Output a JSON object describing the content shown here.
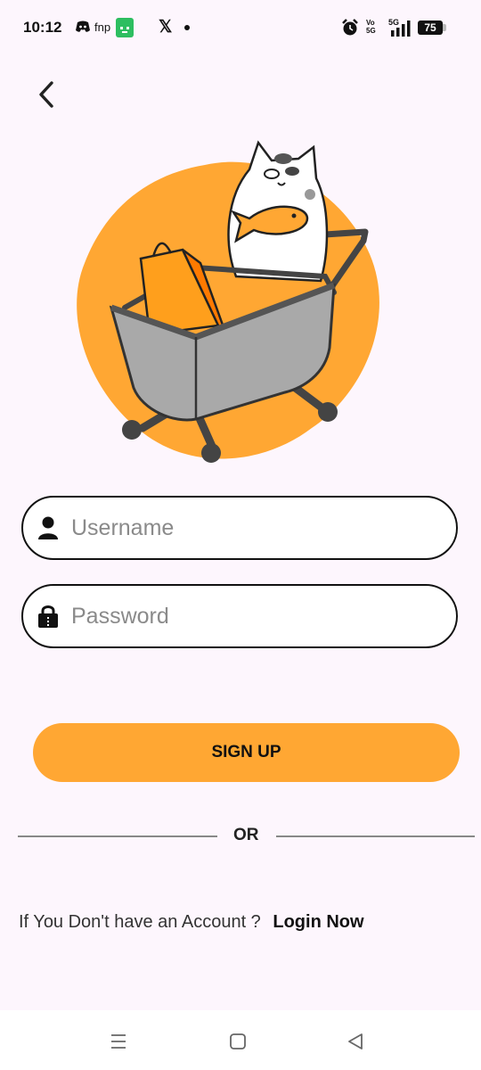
{
  "status_bar": {
    "time": "10:12",
    "app_label": "fnp",
    "battery": "75",
    "network": "5G",
    "volte": "Vo 5G",
    "icons": [
      "discord-icon",
      "fnp-icon",
      "wechat-icon",
      "x-icon",
      "dot-icon",
      "alarm-icon",
      "signal-icon",
      "battery-icon"
    ]
  },
  "header": {
    "back_icon": "chevron-left-icon"
  },
  "form": {
    "username": {
      "placeholder": "Username",
      "value": "",
      "icon": "user-icon"
    },
    "password": {
      "placeholder": "Password",
      "value": "",
      "icon": "lock-icon"
    },
    "signup_label": "SIGN UP",
    "or_label": "OR"
  },
  "footer": {
    "prompt": "If You Don't have an Account ?",
    "login_link": "Login Now"
  },
  "nav": {
    "icons": [
      "menu-icon",
      "home-icon",
      "back-triangle-icon"
    ]
  },
  "colors": {
    "accent": "#FFA733",
    "background": "#FDF6FD",
    "text": "#111111"
  }
}
